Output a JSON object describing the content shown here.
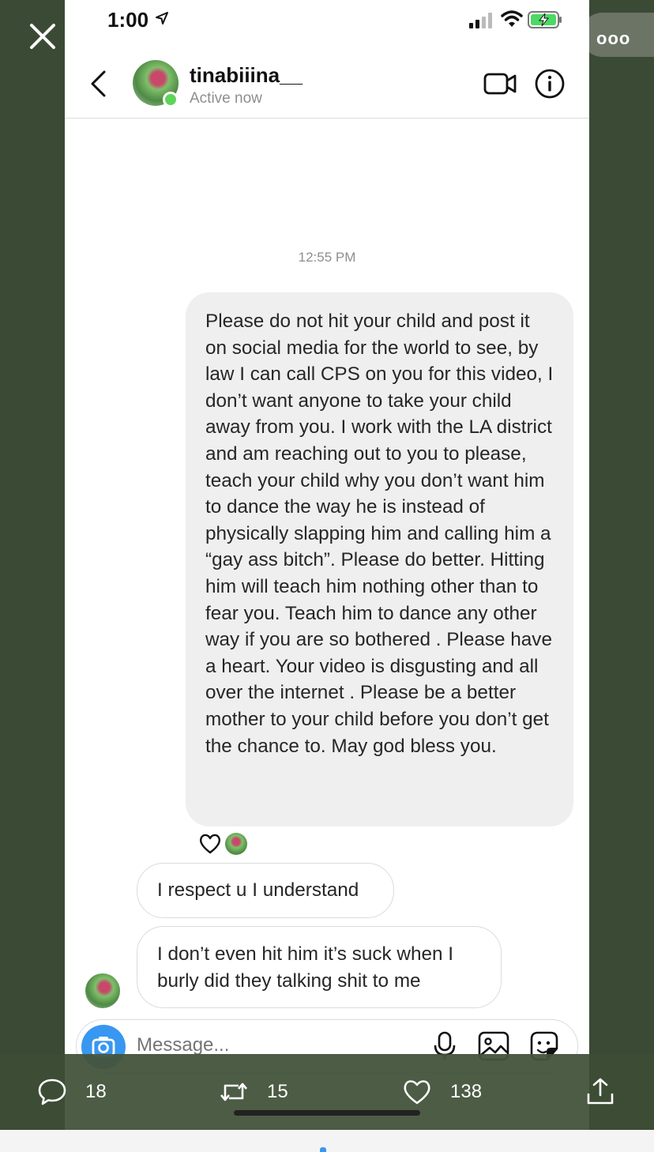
{
  "status_bar": {
    "time": "1:00"
  },
  "chat": {
    "username": "tinabiiina__",
    "presence": "Active now",
    "timestamp": "12:55 PM",
    "outgoing_message": "Please do not hit your child and post it on social media for the world to see, by law I can call CPS on you for this video, I don’t want anyone to take your child away from you. I work with the LA district and am reaching out to you to please, teach your child why you don’t want him to dance the way he is instead of physically slapping him and calling him a “gay ass bitch”. Please do better. Hitting him will teach him nothing other than to fear you. Teach him to dance any other way if you are so bothered . Please have a heart. Your video is disgusting and all over the internet . Please be a better mother to your child before you don’t get the chance to. May god bless you.",
    "incoming_messages": [
      "I respect u I understand",
      "I don’t even hit him it’s suck when I burly did they talking shit to me"
    ],
    "composer_placeholder": "Message..."
  },
  "tweet_actions": {
    "replies": "18",
    "retweets": "15",
    "likes": "138"
  },
  "colors": {
    "viewer_bg": "#3b4a34",
    "accent_blue": "#3897f0",
    "online_green": "#5fd35a",
    "bubble_gray": "#efefef"
  },
  "icons": [
    "close-icon",
    "more-icon",
    "location-arrow-icon",
    "signal-icon",
    "wifi-icon",
    "battery-charging-icon",
    "back-chevron-icon",
    "video-call-icon",
    "info-icon",
    "heart-icon",
    "camera-icon",
    "microphone-icon",
    "gallery-icon",
    "sticker-icon",
    "comment-icon",
    "retweet-icon",
    "like-icon",
    "share-icon"
  ]
}
